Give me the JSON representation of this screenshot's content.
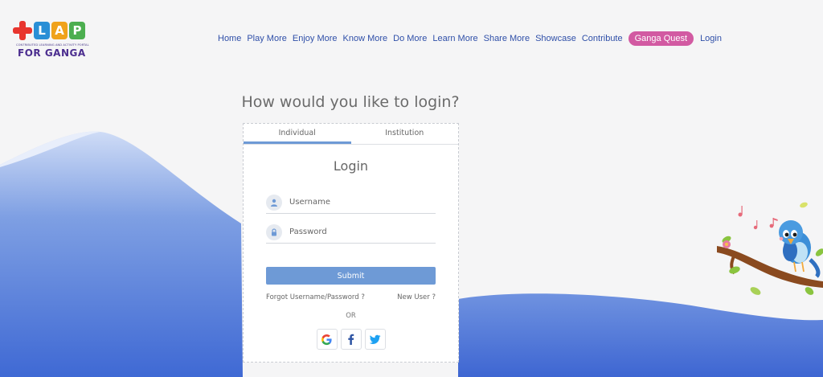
{
  "logo": {
    "letters": [
      "L",
      "A",
      "P"
    ],
    "letter_colors": [
      "#e8352e",
      "#2a8fd6",
      "#f0a21b",
      "#4cae4f"
    ],
    "tagline": "CONTRIBUTED LEARNING AND ACTIVITY PORTAL",
    "subtitle": "FOR GANGA"
  },
  "nav": {
    "items": [
      "Home",
      "Play More",
      "Enjoy More",
      "Know More",
      "Do More",
      "Learn More",
      "Share More",
      "Showcase",
      "Contribute"
    ],
    "highlight": "Ganga Quest",
    "login": "Login"
  },
  "page": {
    "heading": "How would you like to login?"
  },
  "login_card": {
    "tabs": [
      "Individual",
      "Institution"
    ],
    "active_tab": "Individual",
    "title": "Login",
    "username_placeholder": "Username",
    "password_placeholder": "Password",
    "submit_label": "Submit",
    "forgot_label": "Forgot Username/Password ?",
    "new_user_label": "New User ?",
    "or_label": "OR",
    "social_icons": [
      "google-icon",
      "facebook-icon",
      "twitter-icon"
    ]
  },
  "colors": {
    "accent": "#6e9ad6",
    "nav_link": "#2f4fa8",
    "pill": "#d25aa2",
    "hill": "#4f78d9"
  }
}
